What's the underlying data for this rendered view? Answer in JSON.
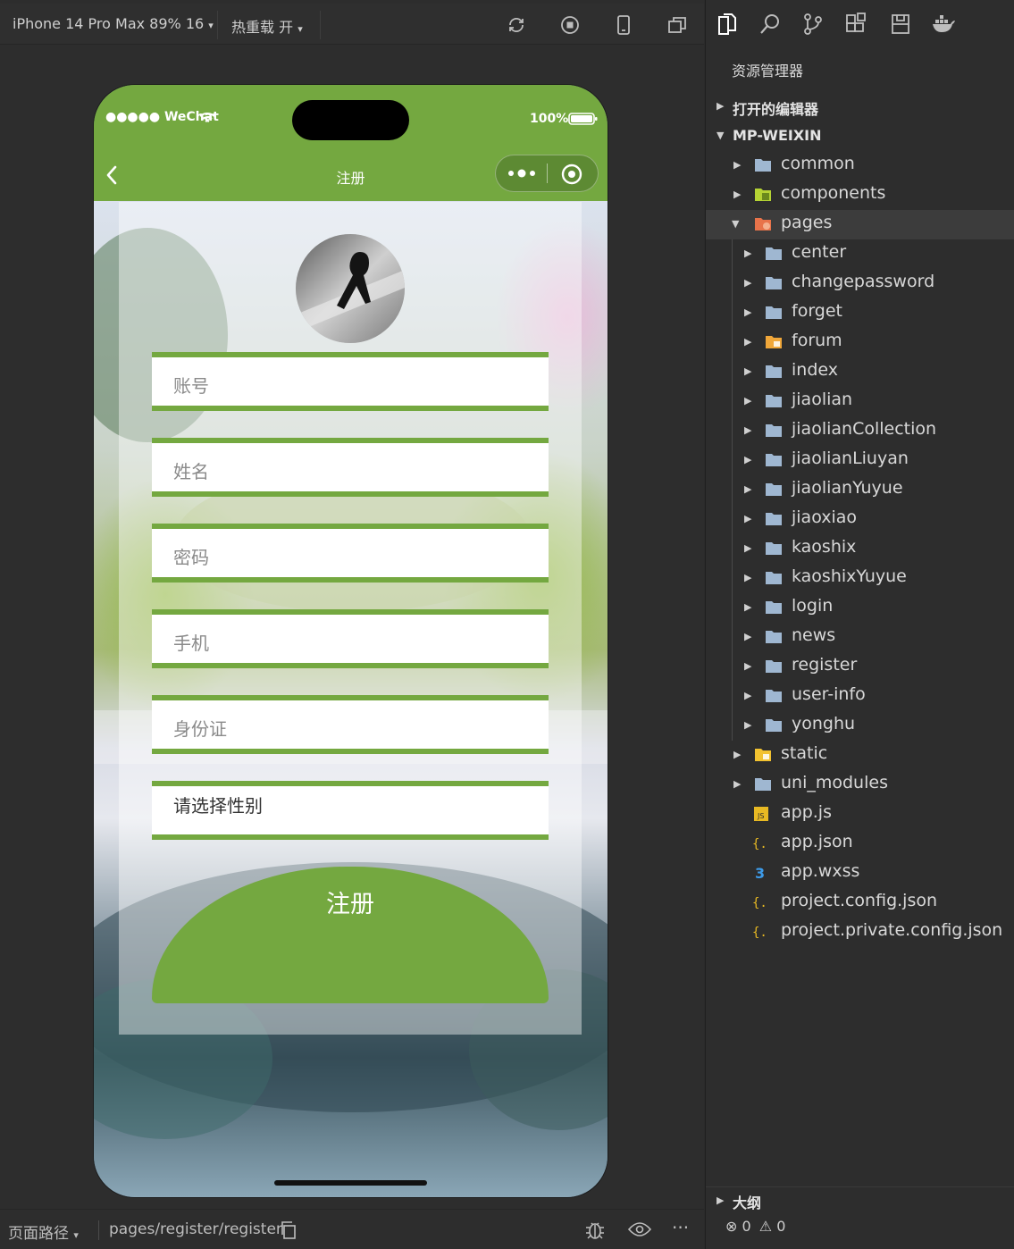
{
  "toolbar": {
    "device": "iPhone 14 Pro Max 89% 16",
    "hot_reload": "热重载 开",
    "device_caret": "▾",
    "hot_caret": "▾"
  },
  "status_bar": {
    "carrier": "●●●●● WeChat",
    "battery": "100%"
  },
  "nav": {
    "title": "注册"
  },
  "form": {
    "fields": [
      {
        "label": "账号"
      },
      {
        "label": "姓名"
      },
      {
        "label": "密码"
      },
      {
        "label": "手机"
      },
      {
        "label": "身份证"
      }
    ],
    "gender_picker": "请选择性别",
    "submit": "注册"
  },
  "bottom_bar": {
    "path_label": "页面路径",
    "path_caret": "▾",
    "path_value": "pages/register/register",
    "more": "···"
  },
  "explorer": {
    "title": "资源管理器",
    "open_editors": "打开的编辑器",
    "project": "MP-WEIXIN",
    "tree": {
      "common": "common",
      "components": "components",
      "pages": "pages",
      "page_folders": [
        "center",
        "changepassword",
        "forget",
        "forum",
        "index",
        "jiaolian",
        "jiaolianCollection",
        "jiaolianLiuyan",
        "jiaolianYuyue",
        "jiaoxiao",
        "kaoshix",
        "kaoshixYuyue",
        "login",
        "news",
        "register",
        "user-info",
        "yonghu"
      ],
      "static": "static",
      "uni_modules": "uni_modules",
      "files": [
        "app.js",
        "app.json",
        "app.wxss",
        "project.config.json",
        "project.private.config.json"
      ]
    },
    "outline": "大纲",
    "errors": "0",
    "warnings": "0"
  },
  "colors": {
    "accent_green": "#74a840",
    "ide_bg": "#2d2d2d",
    "folder": "#9fb7d1",
    "folder_special": "#f0a73a"
  }
}
